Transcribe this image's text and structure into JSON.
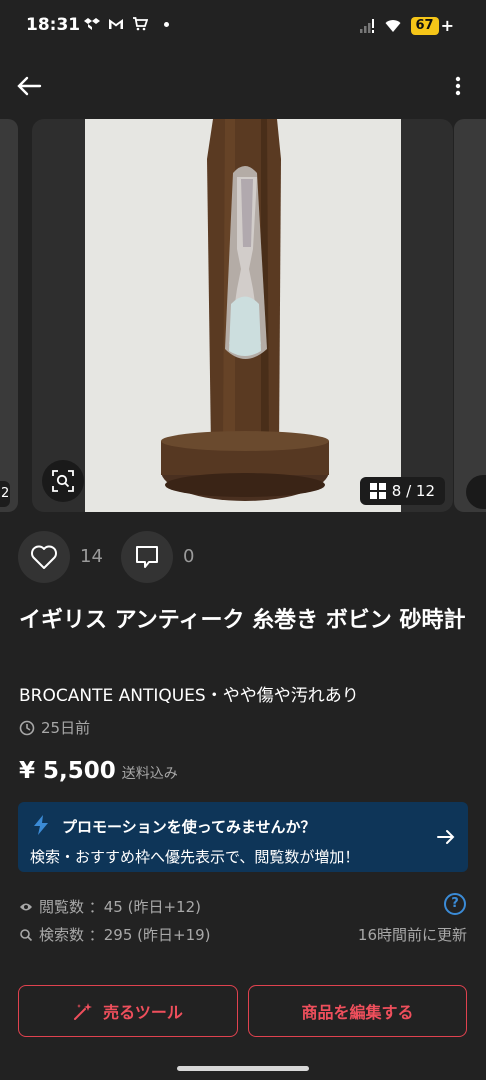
{
  "status_bar": {
    "time": "18:31",
    "battery": "67",
    "icons": [
      "dropbox-icon",
      "gmail-icon",
      "shopping-cart-icon",
      "signal-icon",
      "wifi-icon",
      "battery-icon"
    ]
  },
  "gallery": {
    "counter": "8 / 12",
    "left_counter": "2"
  },
  "reactions": {
    "likes": "14",
    "comments": "0"
  },
  "item": {
    "title": "イギリス アンティーク 糸巻き ボビン 砂時計",
    "subtitle": "BROCANTE ANTIQUES・やや傷や汚れあり",
    "posted": "25日前",
    "price": "¥ 5,500",
    "shipping": "送料込み"
  },
  "promo": {
    "title": "プロモーションを使ってみませんか？",
    "description": "検索・おすすめ枠へ優先表示で、閲覧数が増加！"
  },
  "stats": {
    "views": "閲覧数 ：45 (昨日+12)",
    "searches": "検索数 ：295 (昨日+19)",
    "updated": "16時間前に更新"
  },
  "actions": {
    "sell_tools": "売るツール",
    "edit_item": "商品を編集する"
  },
  "colors": {
    "background": "#222222",
    "accent_red": "#e0424f",
    "promo_bg": "#0e3558",
    "help_blue": "#3b8bd6"
  }
}
